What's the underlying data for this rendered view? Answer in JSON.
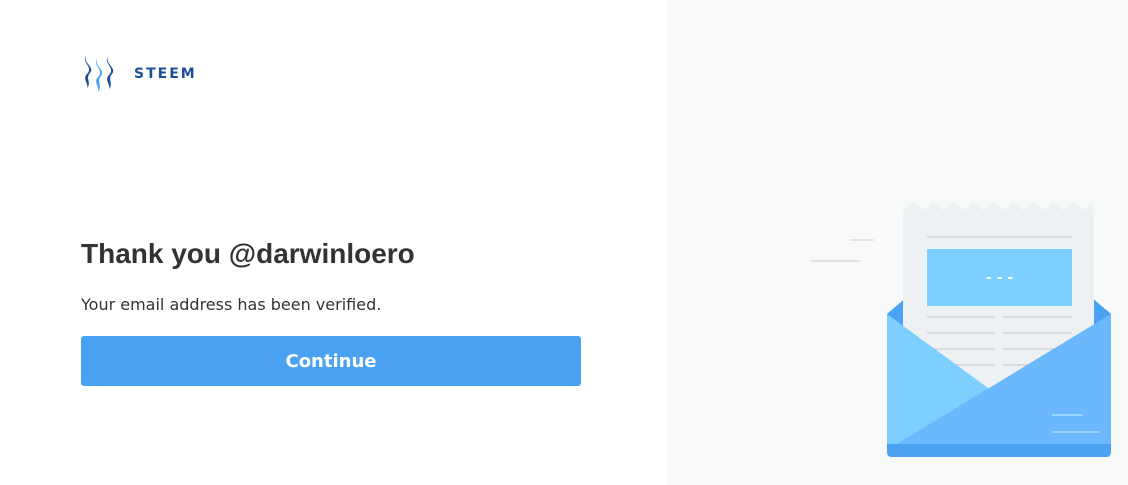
{
  "brand": {
    "name": "STEEM",
    "logo_icon": "steem-logo-icon",
    "brand_color": "#1a5099"
  },
  "main": {
    "title": "Thank you @darwinloero",
    "message": "Your email address has been verified.",
    "continue_label": "Continue"
  },
  "illustration": {
    "icon": "envelope-letter-icon",
    "letter_placeholder": "- - -"
  },
  "colors": {
    "accent": "#4ba2f2",
    "text": "#333333",
    "right_background": "#f8f9f9",
    "envelope_blue": "#6bb8ff",
    "envelope_light": "#7dcfff"
  }
}
